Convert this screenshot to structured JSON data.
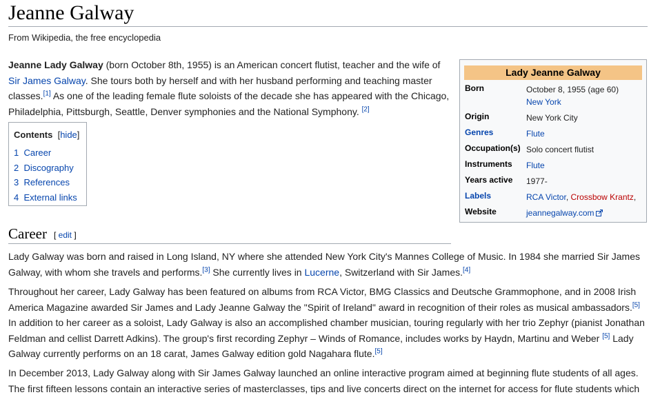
{
  "title": "Jeanne Galway",
  "tagline": "From Wikipedia, the free encyclopedia",
  "intro": {
    "bold": "Jeanne Lady Galway",
    "t1": " (born October 8th, 1955) is an American concert flutist, teacher and the wife of ",
    "link1": "Sir James Galway",
    "t2": ". She tours both by herself and with her husband performing and teaching master classes.",
    "ref1": "[1]",
    "t3": " As one of the leading female flute soloists of the decade she has appeared with the Chicago, Philadelphia, Pittsburgh, Seattle, Denver symphonies and the National Symphony. ",
    "ref2": "[2]"
  },
  "toc": {
    "title": "Contents",
    "hide": "hide",
    "items": [
      {
        "num": "1",
        "label": "Career"
      },
      {
        "num": "2",
        "label": "Discography"
      },
      {
        "num": "3",
        "label": "References"
      },
      {
        "num": "4",
        "label": "External links"
      }
    ]
  },
  "infobox": {
    "heading": "Lady Jeanne Galway",
    "born_label": "Born",
    "born_value": "October 8, 1955 (age 60)",
    "born_place": "New York",
    "origin_label": "Origin",
    "origin_value": "New York City",
    "genres_label": "Genres",
    "genres_value": "Flute",
    "occupation_label": "Occupation(s)",
    "occupation_value": "Solo concert flutist",
    "instruments_label": "Instruments",
    "instruments_value": "Flute",
    "years_label": "Years active",
    "years_value": "1977-",
    "labels_label": "Labels",
    "labels_value1": "RCA Victor",
    "labels_sep": ", ",
    "labels_value2": "Crossbow Krantz",
    "labels_end": ",",
    "website_label": "Website",
    "website_value": "jeannegalway.com"
  },
  "career": {
    "heading": "Career",
    "edit_open": "[ ",
    "edit": "edit",
    "edit_close": " ]",
    "p1": {
      "t1": "Lady Galway was born and raised in Long Island, NY where she attended New York City's Mannes College of Music. In 1984 she married Sir James Galway, with whom she travels and performs.",
      "ref3": "[3]",
      "t2": " She currently lives in ",
      "link": "Lucerne",
      "t3": ", Switzerland with Sir James.",
      "ref4": "[4]"
    },
    "p2": {
      "t1": "Throughout her career, Lady Galway has been featured on albums from RCA Victor, BMG Classics and Deutsche Grammophone, and in 2008 Irish America Magazine awarded Sir James and Lady Jeanne Galway the \"Spirit of Ireland\" award in recognition of their roles as musical ambassadors.",
      "ref5a": "[5]",
      "t2": " In addition to her career as a soloist, Lady Galway is also an accomplished chamber musician, touring regularly with her trio Zephyr (pianist Jonathan Feldman and cellist Darrett Adkins). The group's first recording Zephyr – Winds of Romance, includes works by Haydn, Martinu and Weber ",
      "ref5b": "[5]",
      "t3": " Lady Galway currently performs on an 18 carat, James Galway edition gold Nagahara flute.",
      "ref5c": "[5]"
    },
    "p3": {
      "t1": "In December 2013, Lady Galway along with Sir James Galway launched an online interactive program aimed at beginning flute students of all ages. The first fifteen lessons contain an interactive series of masterclasses, tips and live concerts direct on the internet for access for flute students which"
    }
  }
}
